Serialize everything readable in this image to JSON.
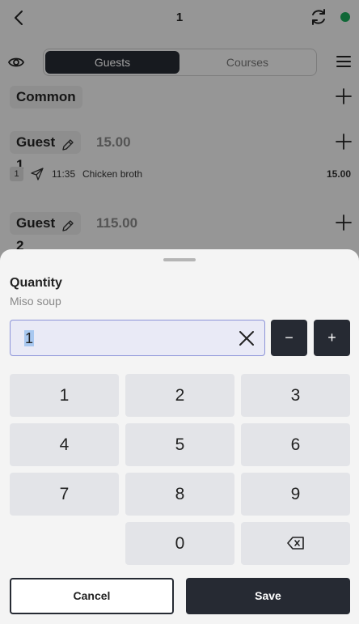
{
  "header": {
    "title": "1"
  },
  "view_toggle": {
    "tabs": [
      {
        "label": "Guests",
        "active": true
      },
      {
        "label": "Courses",
        "active": false
      }
    ]
  },
  "sections": [
    {
      "label": "Common"
    },
    {
      "label": "Guest 1",
      "total": "15.00"
    },
    {
      "label": "Guest 2",
      "total": "115.00"
    }
  ],
  "order_items": [
    {
      "qty": "1",
      "time": "11:35",
      "name": "Chicken broth",
      "price": "15.00"
    }
  ],
  "dialog": {
    "title": "Quantity",
    "subtitle": "Miso soup",
    "input_value": "1",
    "minus_label": "−",
    "plus_label": "+",
    "keys": [
      "1",
      "2",
      "3",
      "4",
      "5",
      "6",
      "7",
      "8",
      "9",
      "0"
    ],
    "cancel_label": "Cancel",
    "save_label": "Save"
  },
  "colors": {
    "primary_dark": "#262a33",
    "status_online": "#1aa85a",
    "input_focus": "#8c93d8"
  }
}
